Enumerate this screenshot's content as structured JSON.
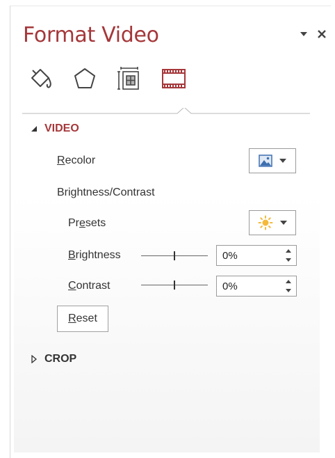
{
  "pane": {
    "title": "Format Video",
    "options_icon": "chevron-down-icon",
    "close_icon": "close-icon"
  },
  "tabs": [
    {
      "name": "fill-line",
      "icon": "paint-bucket-icon"
    },
    {
      "name": "effects",
      "icon": "pentagon-icon"
    },
    {
      "name": "size-properties",
      "icon": "size-properties-icon"
    },
    {
      "name": "video",
      "icon": "film-strip-icon",
      "selected": true
    }
  ],
  "video_section": {
    "label": "VIDEO",
    "expanded": true,
    "recolor": {
      "label_pre": "",
      "label_key": "R",
      "label_post": "ecolor",
      "icon": "picture-icon"
    },
    "brightness_contrast": {
      "label": "Brightness/Contrast",
      "presets": {
        "label_pre": "Pr",
        "label_key": "e",
        "label_post": "sets",
        "icon": "sun-icon"
      },
      "brightness": {
        "label_key": "B",
        "label_post": "rightness",
        "value": "0%",
        "level": 0.5
      },
      "contrast": {
        "label_key": "C",
        "label_post": "ontrast",
        "value": "0%",
        "level": 0.5
      },
      "reset": {
        "label_key": "R",
        "label_post": "eset"
      }
    }
  },
  "crop_section": {
    "label": "CROP",
    "expanded": false
  },
  "colors": {
    "accent": "#a5373a",
    "text": "#333333",
    "border": "#9a9a9a"
  }
}
